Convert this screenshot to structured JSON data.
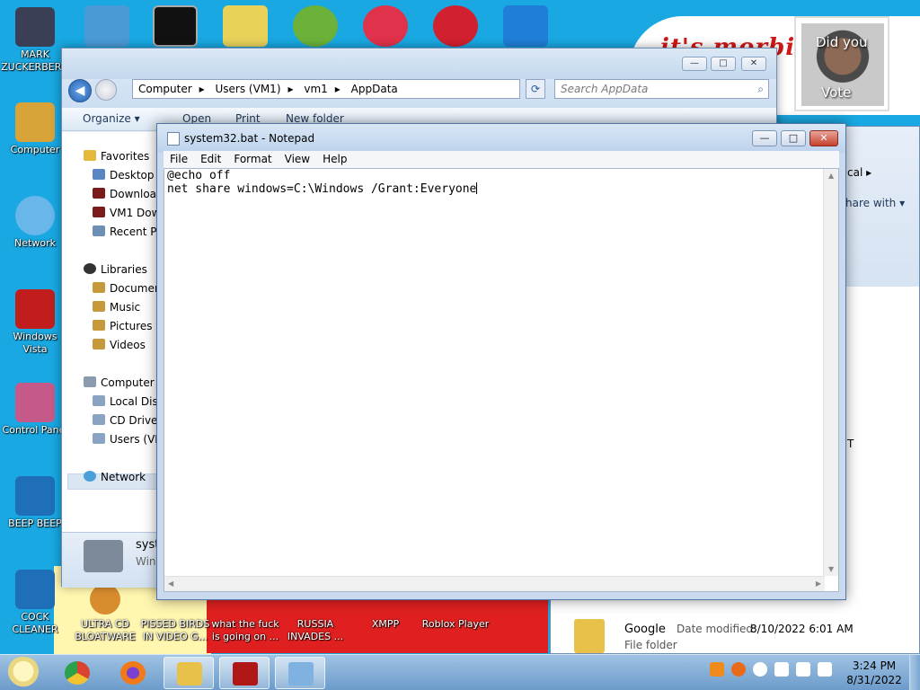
{
  "desktop": {
    "banner_text": "it's morbi",
    "left_icons": [
      {
        "label": "MARK ZUCKERBERG",
        "color": "#3a3f55",
        "icon": "person-icon"
      },
      {
        "label": "Computer",
        "color": "#d8a43a",
        "icon": "computer-icon"
      },
      {
        "label": "Network",
        "color": "#69b6ea",
        "icon": "network-globe-icon"
      },
      {
        "label": "Windows Vista",
        "color": "#c21d1d",
        "icon": "recycle-bin-icon"
      },
      {
        "label": "Control Panel",
        "color": "#c55a8a",
        "icon": "control-panel-icon"
      },
      {
        "label": "BEEP BEEP",
        "color": "#1e6fb8",
        "icon": "blue-book-icon"
      },
      {
        "label": "COCK CLEANER",
        "color": "#1e6fb8",
        "icon": "blue-book-icon"
      }
    ],
    "top_icons": [
      {
        "name": "notes-app-icon",
        "color": "#4a9ad6"
      },
      {
        "name": "cmd-icon",
        "color": "#111111"
      },
      {
        "name": "folder-drive-icon",
        "color": "#e8d25a"
      },
      {
        "name": "angry-birds-pig-icon",
        "color": "#6bb13a"
      },
      {
        "name": "p-app-icon",
        "color": "#e0324b"
      },
      {
        "name": "dev-cpp-icon",
        "color": "#d1202f"
      },
      {
        "name": "blue-box-icon",
        "color": "#1f7ed6"
      }
    ],
    "bottom_icons": [
      {
        "label": "ULTRA CD BLOATWARE",
        "icon": "cd-icon"
      },
      {
        "label": "PISSED BIRDS IN VIDEO G...",
        "icon": "birds-icon"
      },
      {
        "label": "what the fuck is going on ...",
        "icon": "shortcut-icon"
      },
      {
        "label": "RUSSIA INVADES ...",
        "icon": "shortcut-icon"
      },
      {
        "label": "XMPP",
        "icon": "xmpp-icon"
      },
      {
        "label": "Roblox Player",
        "icon": "roblox-icon"
      }
    ],
    "poster": {
      "line1": "Did you",
      "line2": "Vote"
    }
  },
  "explorer": {
    "breadcrumb": [
      "Computer",
      "Users (VM1)",
      "vm1",
      "AppData"
    ],
    "search_placeholder": "Search AppData",
    "commands": {
      "organize": "Organize",
      "open": "Open",
      "print": "Print",
      "new_folder": "New folder"
    },
    "sidebar": {
      "favorites": "Favorites",
      "fav_items": [
        "Desktop",
        "Downloads",
        "VM1 Downloads",
        "Recent Places"
      ],
      "libraries": "Libraries",
      "lib_items": [
        "Documents",
        "Music",
        "Pictures",
        "Videos"
      ],
      "computer": "Computer",
      "comp_items": [
        "Local Disk",
        "CD Drive",
        "Users (VM1)"
      ],
      "network": "Network"
    },
    "details": {
      "name": "syst",
      "type": "Wind"
    }
  },
  "explorer2": {
    "crumb": "cal",
    "share": "hare with",
    "trailing_letter": "T",
    "file_name": "Google",
    "file_type": "File folder",
    "date_label": "Date modified:",
    "date_value": "8/10/2022 6:01 AM"
  },
  "notepad": {
    "title": "system32.bat - Notepad",
    "menu": [
      "File",
      "Edit",
      "Format",
      "View",
      "Help"
    ],
    "lines": [
      "@echo off",
      "net share windows=C:\\Windows /Grant:Everyone"
    ]
  },
  "taskbar": {
    "time": "3:24 PM",
    "date": "8/31/2022",
    "pinned": [
      {
        "name": "chrome-icon",
        "color": "#d9432f"
      },
      {
        "name": "firefox-icon",
        "color": "#f07a1a"
      },
      {
        "name": "explorer-folder-icon",
        "color": "#e8c14a"
      },
      {
        "name": "flash-icon",
        "color": "#b01818"
      },
      {
        "name": "notepad-icon",
        "color": "#7fb2e0"
      }
    ]
  }
}
